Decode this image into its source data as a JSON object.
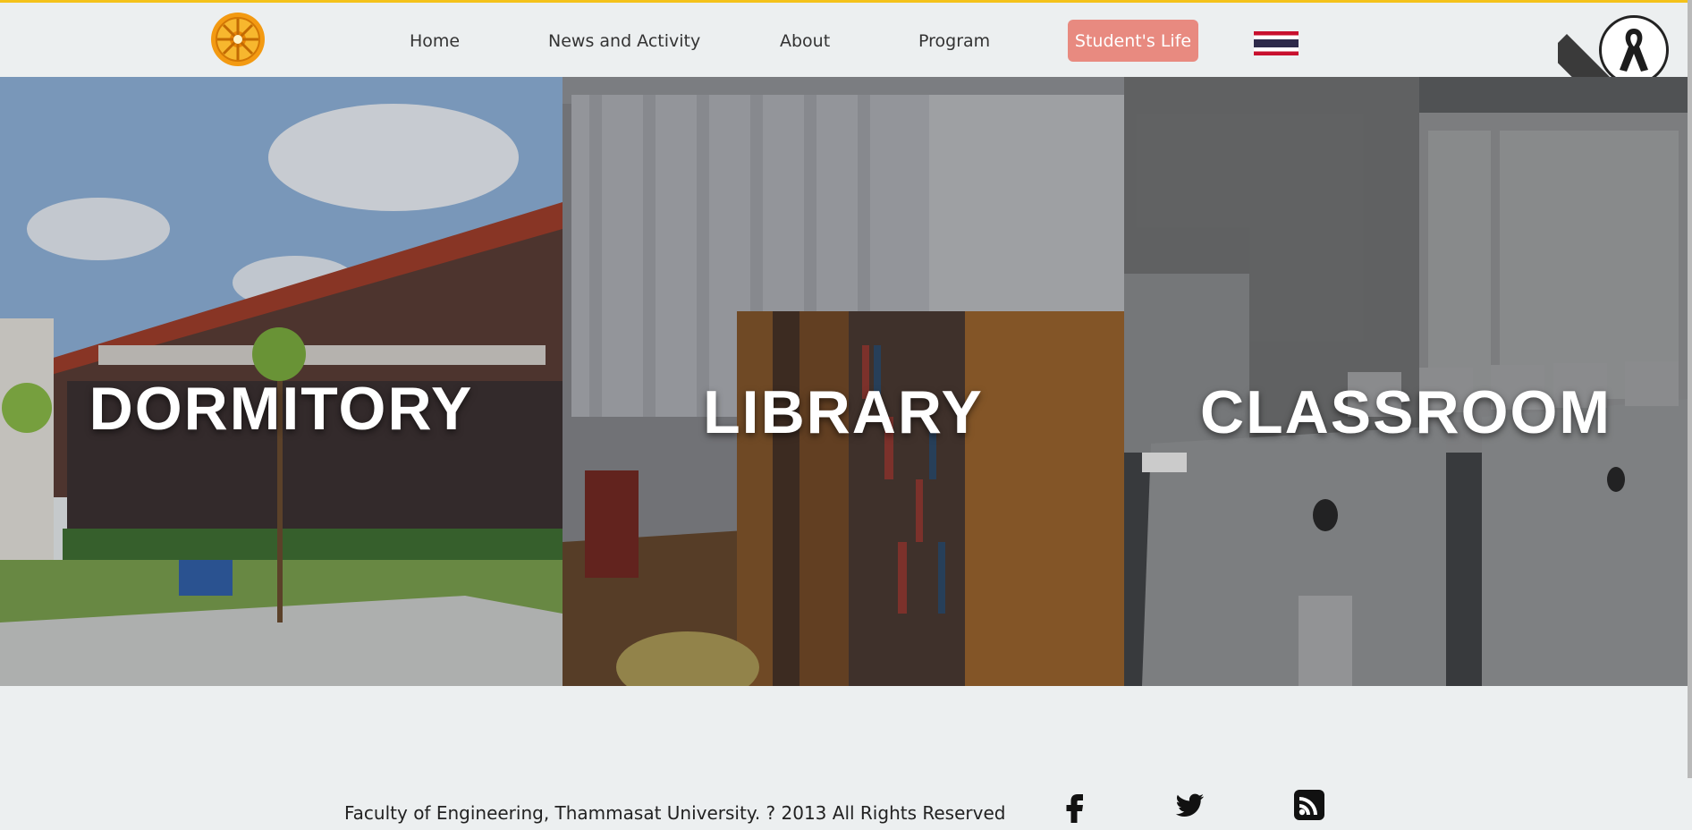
{
  "nav": {
    "logo": "university-logo",
    "links": [
      "Home",
      "News and Activity",
      "About",
      "Program"
    ],
    "active_link": "Student's Life",
    "language_flag": "thai-flag-icon"
  },
  "mourning_badge": "black-ribbon-icon",
  "panels": [
    {
      "label": "DORMITORY"
    },
    {
      "label": "LIBRARY"
    },
    {
      "label": "CLASSROOM"
    }
  ],
  "footer": {
    "copyright": "Faculty of Engineering, Thammasat University. ? 2013 All Rights Reserved",
    "social_icons": [
      "facebook-icon",
      "twitter-icon",
      "rss-icon"
    ]
  },
  "colors": {
    "accent": "#f4c21a",
    "cta": "#e88a80"
  }
}
